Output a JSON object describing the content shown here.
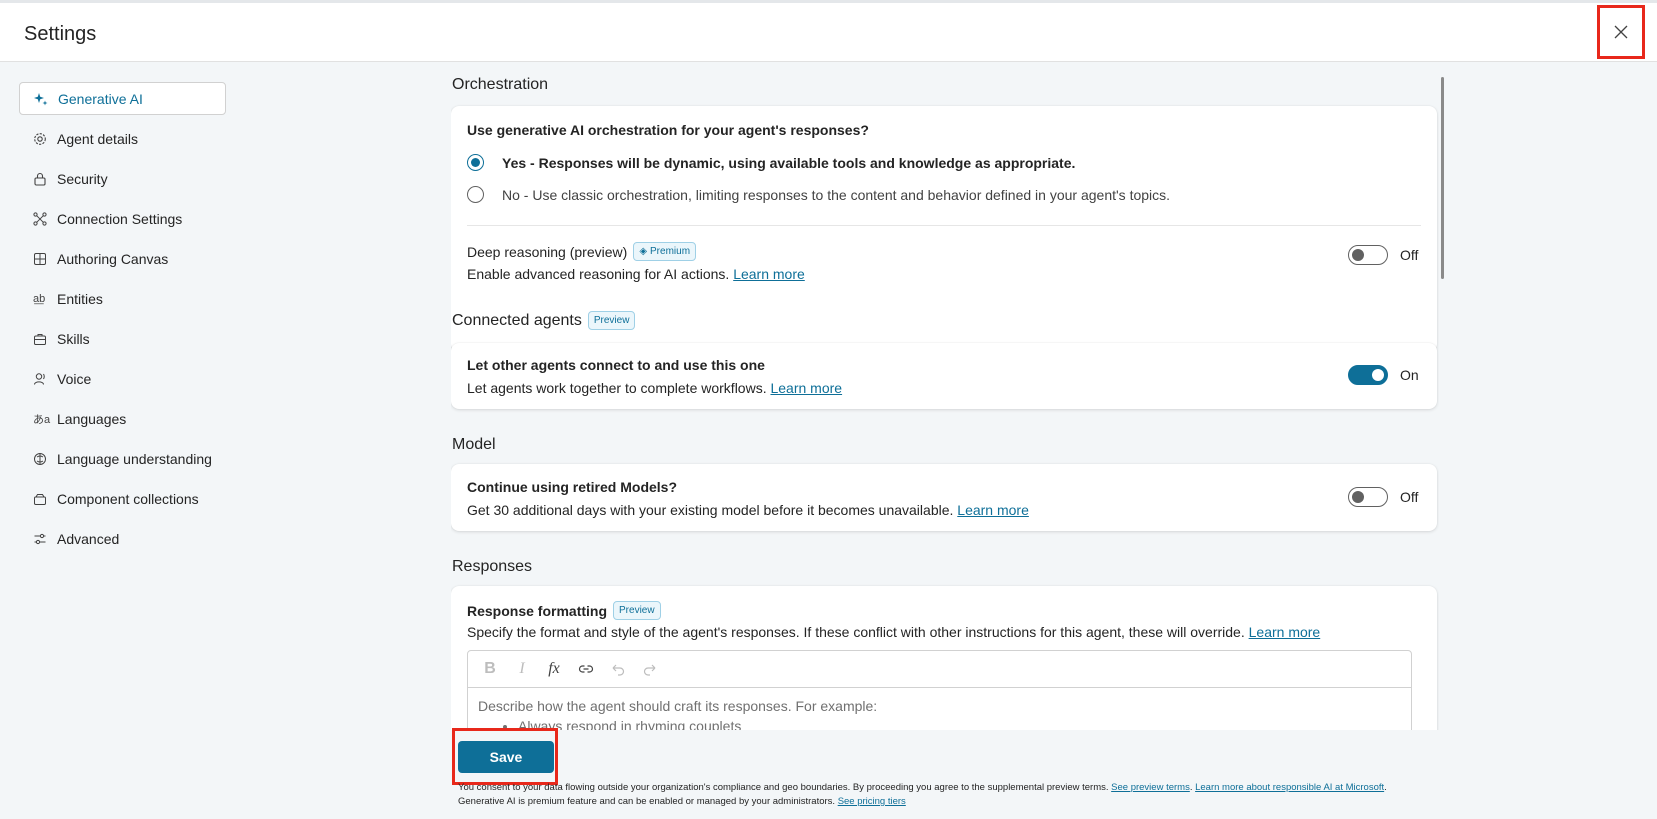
{
  "header": {
    "title": "Settings",
    "close_icon": "close-icon"
  },
  "sidebar": {
    "items": [
      {
        "label": "Generative AI",
        "icon": "sparkle-icon",
        "active": true
      },
      {
        "label": "Agent details",
        "icon": "gear-icon"
      },
      {
        "label": "Security",
        "icon": "lock-icon"
      },
      {
        "label": "Connection Settings",
        "icon": "connection-icon"
      },
      {
        "label": "Authoring Canvas",
        "icon": "grid-icon"
      },
      {
        "label": "Entities",
        "icon": "abc-icon"
      },
      {
        "label": "Skills",
        "icon": "briefcase-icon"
      },
      {
        "label": "Voice",
        "icon": "voice-icon"
      },
      {
        "label": "Languages",
        "icon": "translate-icon"
      },
      {
        "label": "Language understanding",
        "icon": "brain-icon"
      },
      {
        "label": "Component collections",
        "icon": "collection-icon"
      },
      {
        "label": "Advanced",
        "icon": "sliders-icon"
      }
    ]
  },
  "orchestration": {
    "title": "Orchestration",
    "question": "Use generative AI orchestration for your agent's responses?",
    "option_yes": "Yes - Responses will be dynamic, using available tools and knowledge as appropriate.",
    "option_no": "No - Use classic orchestration, limiting responses to the content and behavior defined in your agent's topics.",
    "deep_reasoning_label": "Deep reasoning (preview)",
    "premium_badge": "Premium",
    "deep_reasoning_desc": "Enable advanced reasoning for AI actions.",
    "learn_more": "Learn more",
    "toggle_state": "Off"
  },
  "connected_agents": {
    "title": "Connected agents",
    "badge": "Preview",
    "question": "Let other agents connect to and use this one",
    "desc": "Let agents work together to complete workflows.",
    "learn_more": "Learn more",
    "toggle_state": "On"
  },
  "model": {
    "title": "Model",
    "question": "Continue using retired Models?",
    "desc": "Get 30 additional days with your existing model before it becomes unavailable.",
    "learn_more": "Learn more",
    "toggle_state": "Off"
  },
  "responses": {
    "title": "Responses",
    "formatting_label": "Response formatting",
    "badge": "Preview",
    "desc": "Specify the format and style of the agent's responses. If these conflict with other instructions for this agent, these will override.",
    "learn_more": "Learn more",
    "editor_placeholder": "Describe how the agent should craft its responses. For example:",
    "editor_example": "Always respond in rhyming couplets"
  },
  "footer": {
    "save_label": "Save",
    "consent_line1": "You consent to your data flowing outside your organization's compliance and geo boundaries. By proceeding you agree to the supplemental preview terms.",
    "preview_terms_link": "See preview terms",
    "responsible_ai_link": "Learn more about responsible AI at Microsoft",
    "consent_line2": "Generative AI is premium feature and can be enabled or managed by your administrators.",
    "pricing_link": "See pricing tiers"
  },
  "colors": {
    "accent": "#0e6f98",
    "highlight": "#e8281b"
  }
}
